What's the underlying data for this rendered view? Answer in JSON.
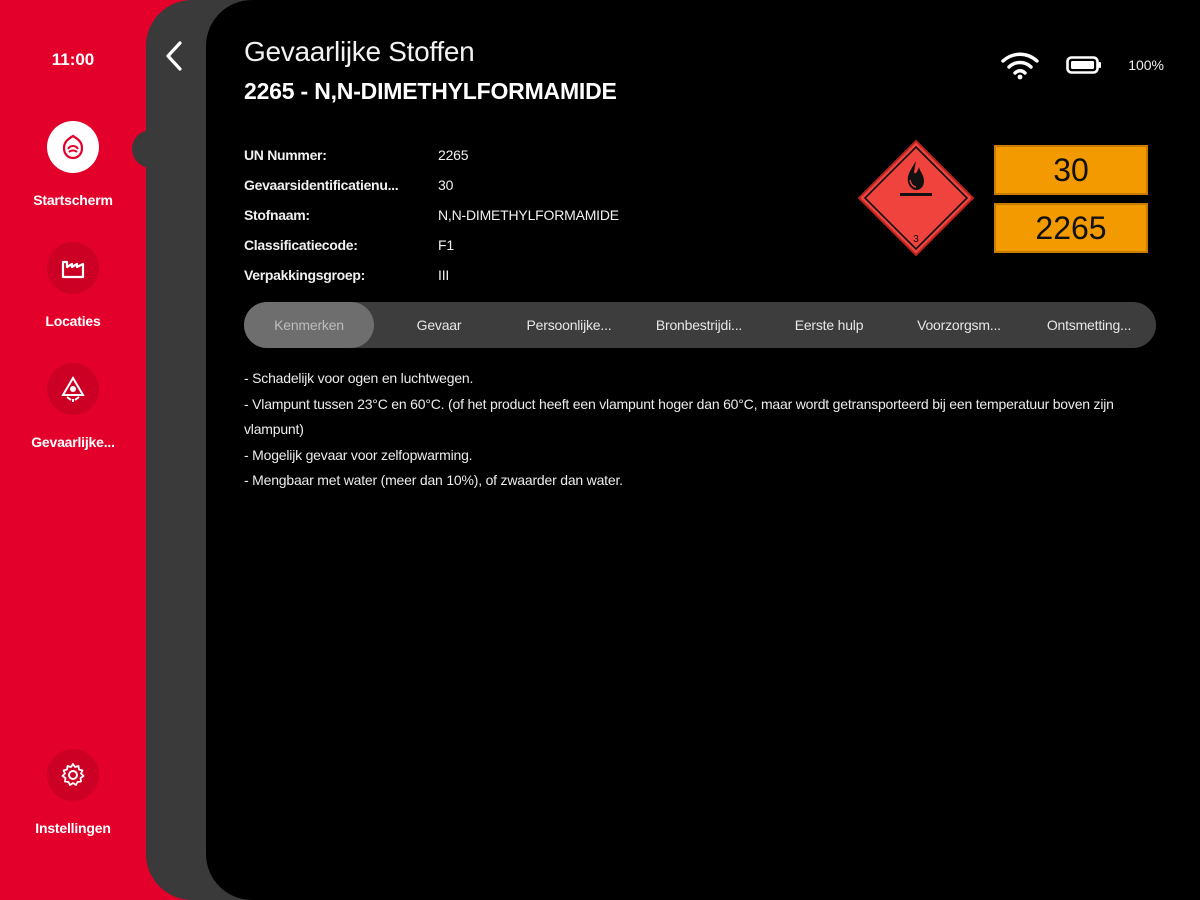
{
  "rail": {
    "time": "11:00",
    "items": [
      {
        "label": "Startscherm",
        "icon": "fire-helmet-icon",
        "active": true
      },
      {
        "label": "Locaties",
        "icon": "factory-icon",
        "active": false
      },
      {
        "label": "Gevaarlijke...",
        "icon": "hazard-icon",
        "active": false
      },
      {
        "label": "Instellingen",
        "icon": "gear-icon",
        "active": false
      }
    ]
  },
  "header": {
    "title": "Gevaarlijke Stoffen",
    "subtitle": "2265 - N,N-DIMETHYLFORMAMIDE"
  },
  "status": {
    "wifi_icon": "wifi-icon",
    "battery_icon": "battery-icon",
    "battery": "100%"
  },
  "info": [
    {
      "key": "UN Nummer:",
      "value": "2265"
    },
    {
      "key": "Gevaarsidentificatienu...",
      "value": "30"
    },
    {
      "key": "Stofnaam:",
      "value": "N,N-DIMETHYLFORMAMIDE"
    },
    {
      "key": "Classificatiecode:",
      "value": "F1"
    },
    {
      "key": "Verpakkingsgroep:",
      "value": "III"
    }
  ],
  "label": {
    "diamond_class": "3",
    "hazard_id": "30",
    "un_number": "2265",
    "orange_color": "#f39a00",
    "diamond_color": "#f0433e"
  },
  "tabs": [
    {
      "label": "Kenmerken",
      "active": true
    },
    {
      "label": "Gevaar",
      "active": false
    },
    {
      "label": "Persoonlijke...",
      "active": false
    },
    {
      "label": "Bronbestrijdi...",
      "active": false
    },
    {
      "label": "Eerste hulp",
      "active": false
    },
    {
      "label": "Voorzorgsm...",
      "active": false
    },
    {
      "label": "Ontsmetting...",
      "active": false
    }
  ],
  "description": [
    "- Schadelijk voor ogen en luchtwegen.",
    "- Vlampunt tussen 23°C en 60°C. (of het product heeft een vlampunt hoger dan 60°C, maar wordt getransporteerd bij een temperatuur boven zijn vlampunt)",
    "- Mogelijk gevaar voor zelfopwarming.",
    "- Mengbaar met water (meer dan 10%), of zwaarder dan water."
  ],
  "colors": {
    "rail": "#e3002a",
    "panel": "#3a3a3a",
    "background": "#000000"
  }
}
